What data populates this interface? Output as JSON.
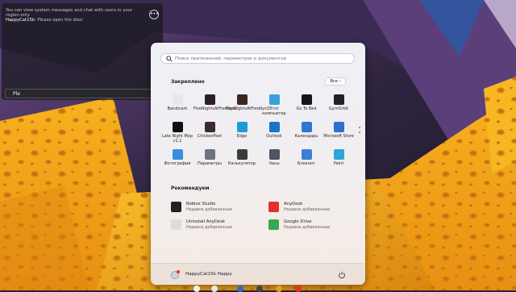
{
  "chat": {
    "system_message": "You can view system messages and chat with users in your region only.",
    "user": "HappyCat15k:",
    "message": "Please open the door",
    "input_value": "Ple"
  },
  "start_menu": {
    "search_placeholder": "Поиск приложений, параметров и документов",
    "pinned_title": "Закреплено",
    "all_button": "Все",
    "pinned_apps": [
      {
        "label": "Bandicam",
        "icon": "bandicam-icon",
        "color": "#e8e8e8"
      },
      {
        "label": "FiveNightsAtFreddys2",
        "icon": "fnaf2-icon",
        "color": "#2a1e2e"
      },
      {
        "label": "FiveNightsAtFreddys3",
        "icon": "fnaf3-icon",
        "color": "#3a2820"
      },
      {
        "label": "Этот компьютер",
        "icon": "this-pc-icon",
        "color": "#3aa0e0"
      },
      {
        "label": "Go To Bed",
        "icon": "go-to-bed-icon",
        "color": "#151515"
      },
      {
        "label": "GymOrbit",
        "icon": "gymorbit-icon",
        "color": "#222222"
      },
      {
        "label": "Late Night Mop v1.1",
        "icon": "late-night-mop-icon",
        "color": "#101010"
      },
      {
        "label": "ChickenFeet",
        "icon": "chickenfeet-icon",
        "color": "#3b2a30"
      },
      {
        "label": "Edge",
        "icon": "edge-icon",
        "color": "#1f9bd8"
      },
      {
        "label": "Outlook",
        "icon": "outlook-icon",
        "color": "#1a73c8"
      },
      {
        "label": "Календарь",
        "icon": "calendar-icon",
        "color": "#2b78d0"
      },
      {
        "label": "Microsoft Store",
        "icon": "store-icon",
        "color": "#2e6fd1"
      },
      {
        "label": "Фотографии",
        "icon": "photos-icon",
        "color": "#3b8de0"
      },
      {
        "label": "Параметры",
        "icon": "settings-icon",
        "color": "#6b7280"
      },
      {
        "label": "Калькулятор",
        "icon": "calculator-icon",
        "color": "#3c3c3c"
      },
      {
        "label": "Часы",
        "icon": "clock-icon",
        "color": "#4b5563"
      },
      {
        "label": "Блокнот",
        "icon": "notepad-icon",
        "color": "#3a7fd5"
      },
      {
        "label": "Paint",
        "icon": "paint-icon",
        "color": "#2aa6d8"
      }
    ],
    "recommended_title": "Рекомендуем",
    "recommended": [
      {
        "name": "Roblox Studio",
        "sub": "Недавно добавленные",
        "icon": "roblox-studio-icon",
        "color": "#222222"
      },
      {
        "name": "AnyDesk",
        "sub": "Недавно добавленные",
        "icon": "anydesk-icon",
        "color": "#e0322b"
      },
      {
        "name": "Uninstall AnyDesk",
        "sub": "Недавно добавленные",
        "icon": "uninstall-anydesk-icon",
        "color": "#d9dce2"
      },
      {
        "name": "Google Drive",
        "sub": "Недавно добавленные",
        "icon": "google-drive-icon",
        "color": "#34a853"
      }
    ],
    "user_name": "HappyCat15k Happy"
  },
  "colors": {
    "accent": "#2b78d0",
    "cheese": "#f2a51c",
    "sky": "#3d2f52"
  }
}
